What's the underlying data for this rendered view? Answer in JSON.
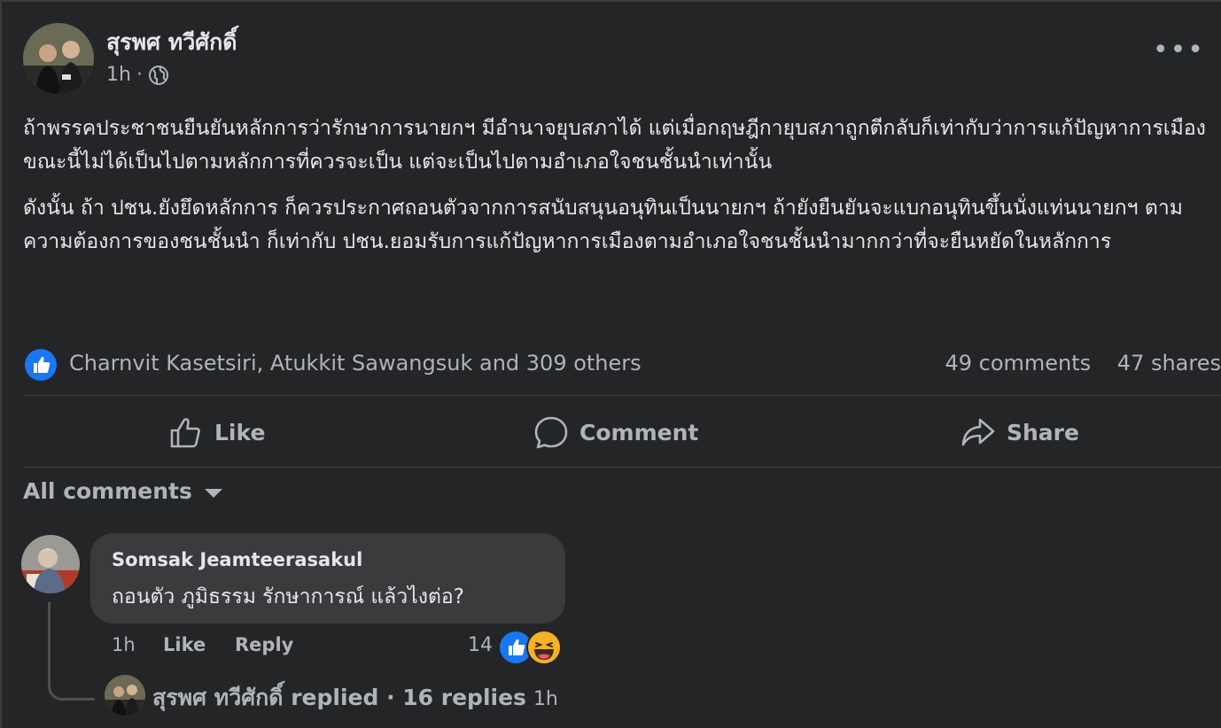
{
  "post": {
    "author": "สุรพศ ทวีศักดิ์",
    "time": "1h",
    "time_separator": "·",
    "paragraphs": [
      "ถ้าพรรคประชาชนยืนยันหลักการว่ารักษาการนายกฯ มีอำนาจยุบสภาได้ แต่เมื่อกฤษฎีกายุบสภาถูกตีกลับก็เท่ากับว่าการแก้ปัญหาการเมืองขณะนี้ไม่ได้เป็นไปตามหลักการที่ควรจะเป็น แต่จะเป็นไปตามอำเภอใจชนชั้นนำเท่านั้น",
      "ดังนั้น ถ้า ปชน.ยังยึดหลักการ ก็ควรประกาศถอนตัวจากการสนับสนุนอนุทินเป็นนายกฯ ถ้ายังยืนยันจะแบกอนุทินขึ้นนั่งแท่นนายกฯ ตามความต้องการของชนชั้นนำ ก็เท่ากับ ปชน.ยอมรับการแก้ปัญหาการเมืองตามอำเภอใจชนชั้นนำมากกว่าที่จะยืนหยัดในหลักการ"
    ],
    "reactions_text": "Charnvit Kasetsiri, Atukkit Sawangsuk and 309 others",
    "comments_count": "49 comments",
    "shares_count": "47 shares"
  },
  "actions": {
    "like": "Like",
    "comment": "Comment",
    "share": "Share"
  },
  "comments_filter": "All comments",
  "comment": {
    "author": "Somsak Jeamteerasakul",
    "text": "ถอนตัว ภูมิธรรม รักษาการณ์ แล้วไงต่อ?",
    "time": "1h",
    "like_label": "Like",
    "reply_label": "Reply",
    "reaction_count": "14"
  },
  "reply_summary": {
    "text": "สุรพศ ทวีศักดิ์ replied · 16 replies",
    "time": "1h"
  },
  "colors": {
    "background": "#242526",
    "bubble": "#3a3b3c",
    "text_primary": "#e4e6eb",
    "text_secondary": "#b0b3b8",
    "like_blue": "#1877f2",
    "haha_yellow": "#f7b125"
  },
  "icons": {
    "visibility": "globe-icon",
    "menu": "more-dots-icon",
    "like": "thumbs-up-icon",
    "comment": "speech-bubble-icon",
    "share": "share-arrow-icon",
    "filter": "caret-down-icon"
  }
}
